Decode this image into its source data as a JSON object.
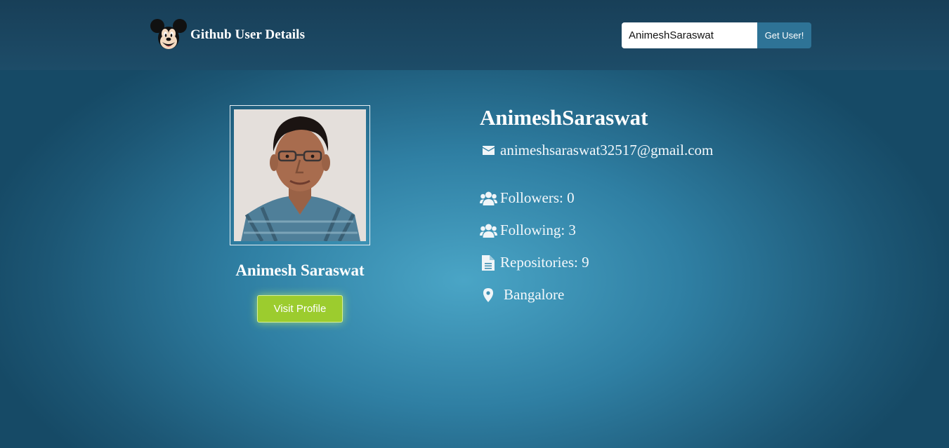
{
  "header": {
    "title": "Github User Details",
    "logo_icon": "mickey-mouse-logo"
  },
  "search": {
    "value": "AnimeshSaraswat",
    "button_label": "Get User!"
  },
  "profile": {
    "display_name": "Animesh Saraswat",
    "visit_button_label": "Visit Profile",
    "username": "AnimeshSaraswat",
    "email": "animeshsaraswat32517@gmail.com",
    "followers_text": "Followers: 0",
    "following_text": "Following: 3",
    "repositories_text": "Repositories: 9",
    "location": "Bangalore"
  },
  "colors": {
    "background": "#2f7fa3",
    "header": "#1b4661",
    "button_accent": "#2e7396",
    "visit_button": "#9ccc2e"
  },
  "icons": {
    "email": "envelope-icon",
    "followers": "users-icon",
    "following": "users-icon",
    "repositories": "document-icon",
    "location": "map-marker-icon"
  }
}
